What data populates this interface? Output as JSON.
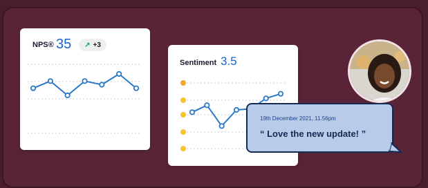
{
  "nps": {
    "label": "NPS®",
    "score": "35",
    "change": "+3",
    "trend_icon": "arrow-up-right-icon",
    "values": [
      2,
      3,
      1,
      3,
      2.5,
      4,
      2
    ]
  },
  "sentiment": {
    "label": "Sentiment",
    "score": "3.5",
    "emoji_scale": [
      "excited-face-icon",
      "happy-face-icon",
      "smile-face-icon",
      "neutral-face-icon",
      "sad-face-icon"
    ],
    "values": [
      2.6,
      3.2,
      1.4,
      2.8,
      2.9,
      3.8,
      4.2
    ]
  },
  "feedback": {
    "timestamp": "19th December 2021, 11.56pm",
    "quote": "“ Love the new update! ”"
  },
  "colors": {
    "accent": "#1c62c9",
    "line": "#2a78c9",
    "background": "#4a1d2e",
    "bubble": "#b8cbe8"
  }
}
